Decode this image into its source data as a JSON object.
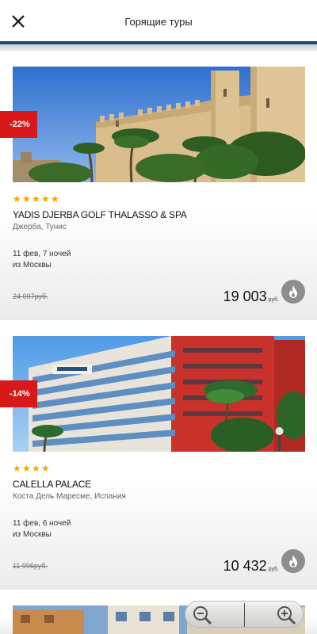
{
  "header": {
    "title": "Горящие туры",
    "close_icon": "close-icon",
    "accent_color": "#1b4c78"
  },
  "tours": [
    {
      "discount": "-22%",
      "stars": 5,
      "name": "YADIS DJERBA GOLF THALASSO & SPA",
      "location": "Джерба,  Тунис",
      "dates": "11 фев, 7 ночей",
      "departure": "из Москвы",
      "old_price": "24 097руб.",
      "price": "19 003",
      "currency": "руб.",
      "hot_icon": "fire-icon"
    },
    {
      "discount": "-14%",
      "stars": 4,
      "name": "CALELLA PALACE",
      "location": "Коста Дель Маресме,  Испания",
      "dates": "11 фев, 6 ночей",
      "departure": "из Москвы",
      "old_price": "11 996руб.",
      "price": "10 432",
      "currency": "руб.",
      "hot_icon": "fire-icon"
    }
  ],
  "zoom_control": {
    "zoom_out_icon": "zoom-out-icon",
    "zoom_in_icon": "zoom-in-icon"
  },
  "colors": {
    "discount_badge": "#d7191a",
    "stars": "#f5a300",
    "hot_badge": "#8d8d8d"
  }
}
